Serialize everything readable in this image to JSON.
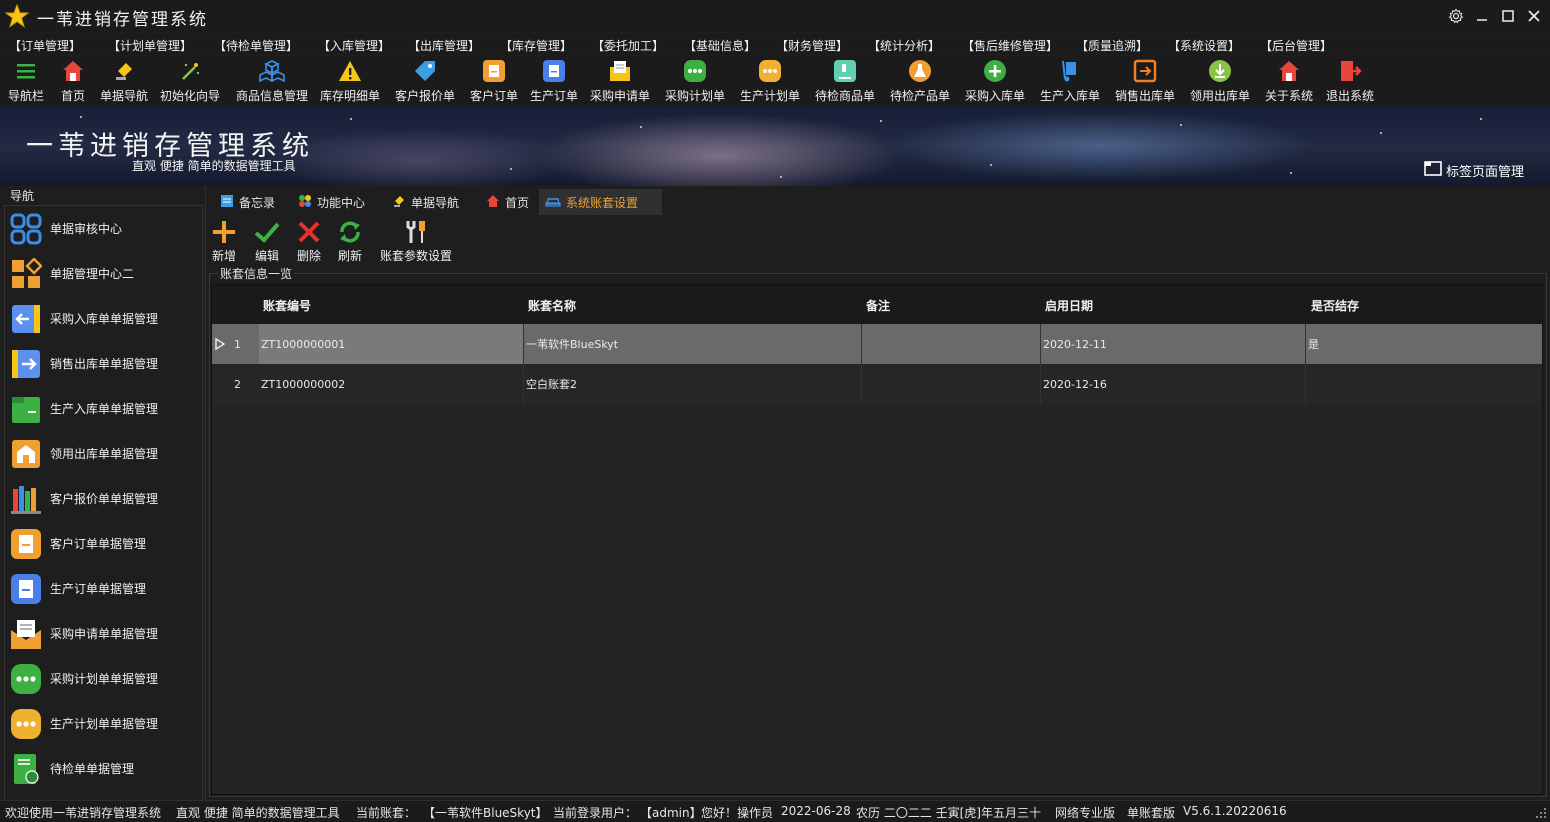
{
  "app": {
    "title": "一苇进销存管理系统"
  },
  "menu": [
    "【订单管理】",
    "【计划单管理】",
    "【待检单管理】",
    "【入库管理】",
    "【出库管理】",
    "【库存管理】",
    "【委托加工】",
    "【基础信息】",
    "【财务管理】",
    "【统计分析】",
    "【售后维修管理】",
    "【质量追溯】",
    "【系统设置】",
    "【后台管理】"
  ],
  "toolbar": [
    "导航栏",
    "首页",
    "单据导航",
    "初始化向导",
    "商品信息管理",
    "库存明细单",
    "客户报价单",
    "客户订单",
    "生产订单",
    "采购申请单",
    "采购计划单",
    "生产计划单",
    "待检商品单",
    "待检产品单",
    "采购入库单",
    "生产入库单",
    "销售出库单",
    "领用出库单",
    "关于系统",
    "退出系统"
  ],
  "banner": {
    "title": "一苇进销存管理系统",
    "subtitle": "直观 便捷 简单的数据管理工具",
    "tab_manage": "标签页面管理"
  },
  "nav": {
    "header": "导航",
    "items": [
      "单据审核中心",
      "单据管理中心二",
      "采购入库单单据管理",
      "销售出库单单据管理",
      "生产入库单单据管理",
      "领用出库单单据管理",
      "客户报价单单据管理",
      "客户订单单据管理",
      "生产订单单据管理",
      "采购申请单单据管理",
      "采购计划单单据管理",
      "生产计划单单据管理",
      "待检单单据管理"
    ]
  },
  "tabs": [
    "备忘录",
    "功能中心",
    "单据导航",
    "首页",
    "系统账套设置"
  ],
  "actions": [
    "新增",
    "编辑",
    "删除",
    "刷新",
    "账套参数设置"
  ],
  "group_title": "账套信息一览",
  "grid": {
    "columns": [
      "账套编号",
      "账套名称",
      "备注",
      "启用日期",
      "是否结存"
    ],
    "rows": [
      {
        "num": "1",
        "code": "ZT1000000001",
        "name": "一苇软件BlueSkyt",
        "note": "",
        "date": "2020-12-11",
        "closed": "是"
      },
      {
        "num": "2",
        "code": "ZT1000000002",
        "name": "空白账套2",
        "note": "",
        "date": "2020-12-16",
        "closed": ""
      }
    ]
  },
  "status": {
    "welcome": "欢迎使用一苇进销存管理系统",
    "slogan": "直观 便捷 简单的数据管理工具",
    "account_label": "当前账套：",
    "account": "【一苇软件BlueSkyt】",
    "user_label": "当前登录用户：",
    "user": "【admin】",
    "greeting": "您好！操作员",
    "date": "2022-06-28",
    "lunar": "农历 二〇二二 壬寅[虎]年五月三十",
    "edition": "网络专业版",
    "mode": "单账套版",
    "version": "V5.6.1.20220616"
  }
}
